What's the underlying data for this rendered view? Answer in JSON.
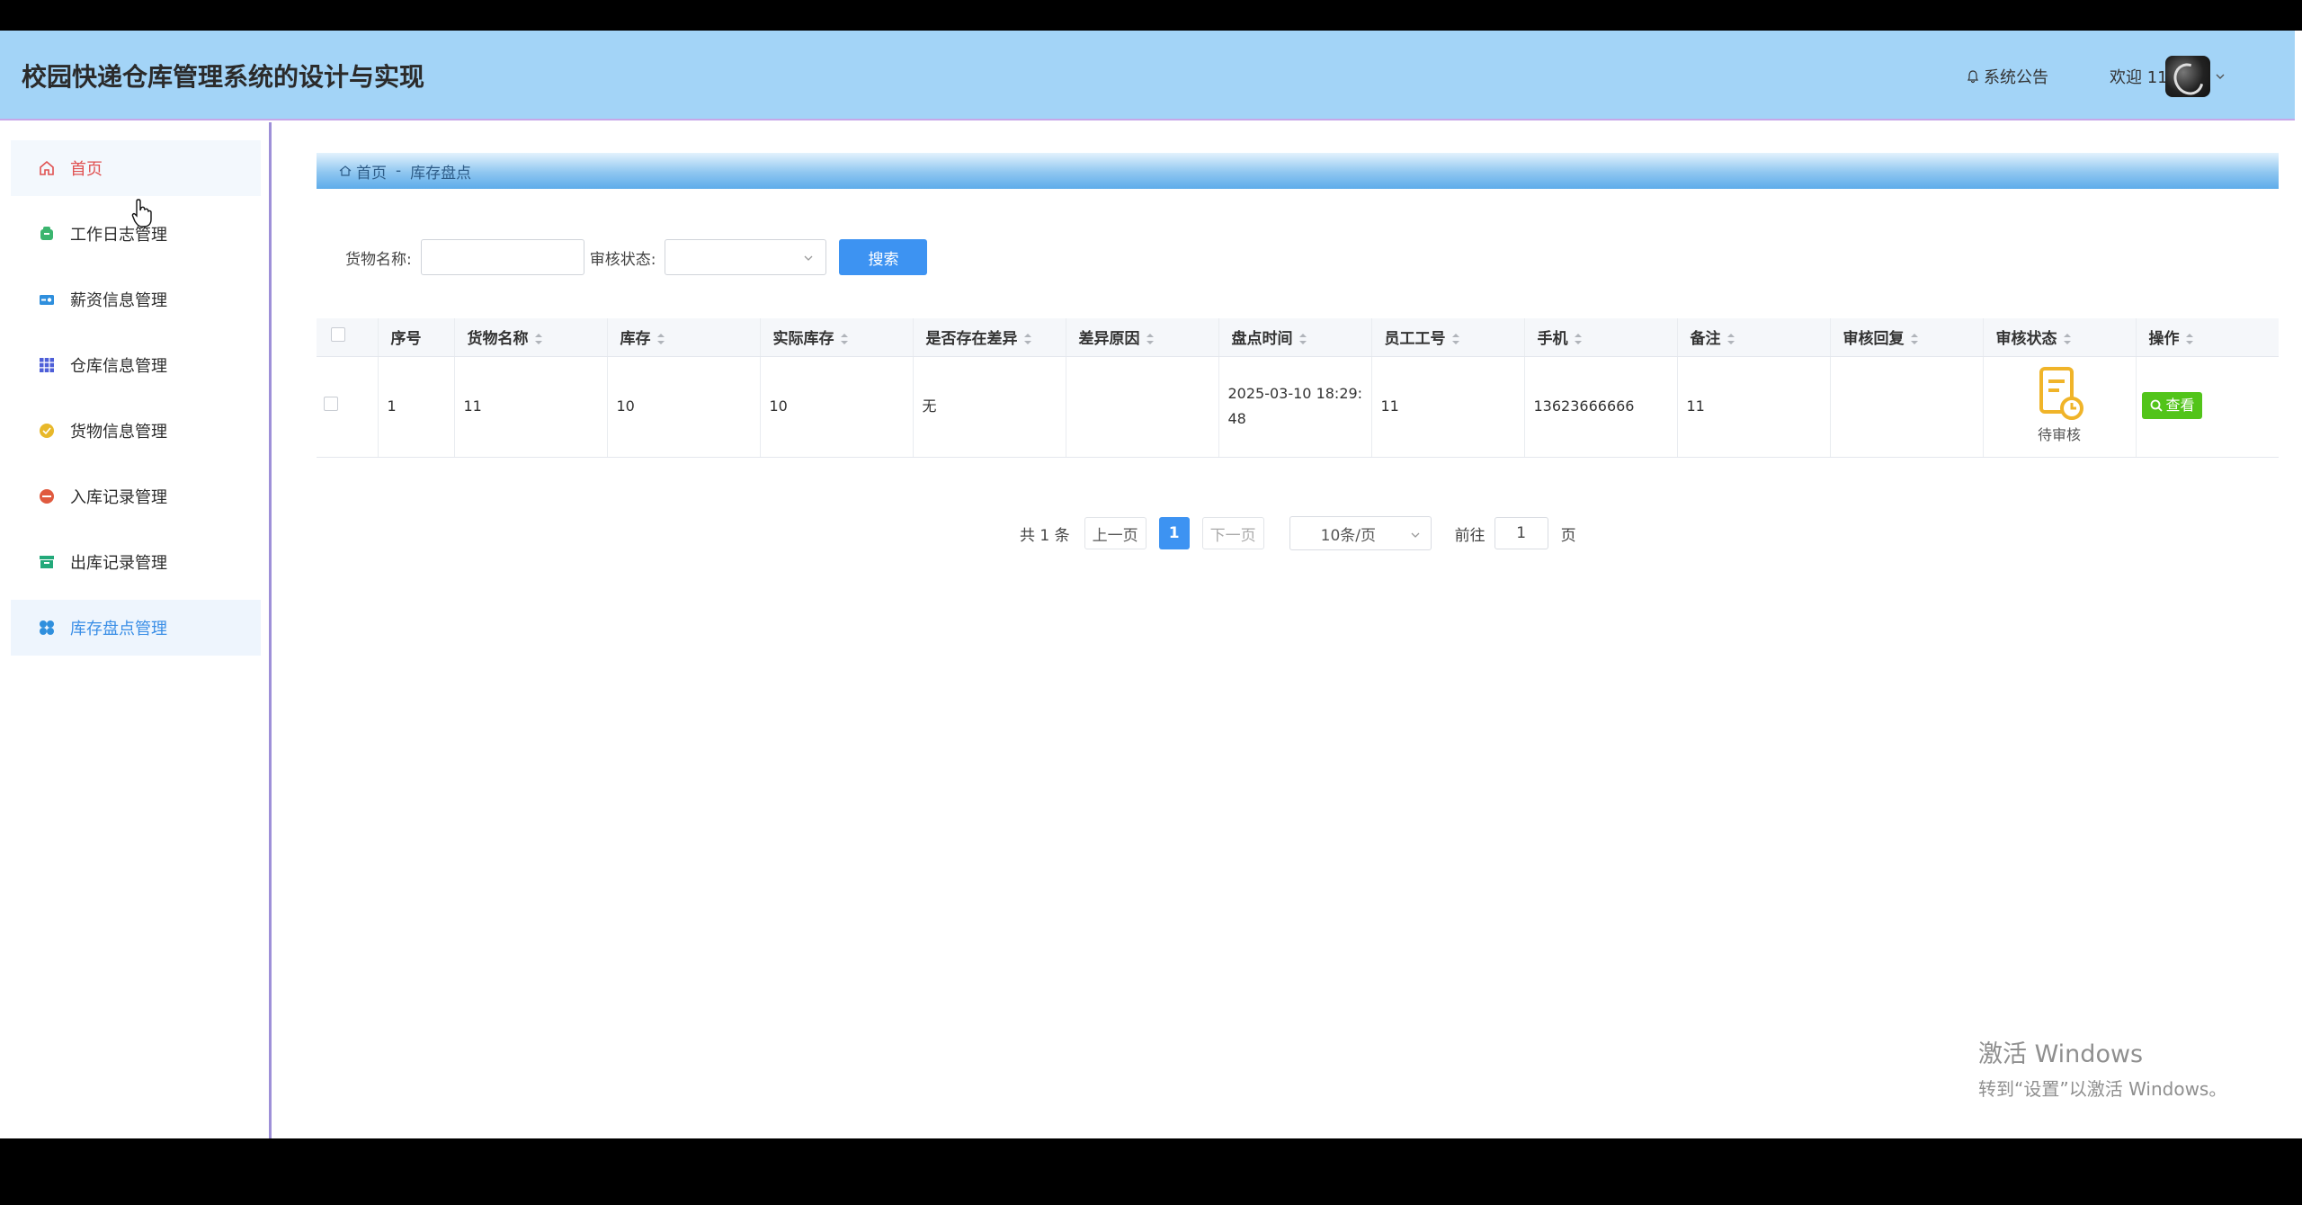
{
  "header": {
    "title": "校园快递仓库管理系统的设计与实现",
    "notice_label": "系统公告",
    "welcome_text": "欢迎 11"
  },
  "sidebar": {
    "items": [
      {
        "label": "首页",
        "icon": "home-icon",
        "active": true
      },
      {
        "label": "工作日志管理",
        "icon": "worklog-icon"
      },
      {
        "label": "薪资信息管理",
        "icon": "salary-icon"
      },
      {
        "label": "仓库信息管理",
        "icon": "warehouse-icon"
      },
      {
        "label": "货物信息管理",
        "icon": "goods-icon"
      },
      {
        "label": "入库记录管理",
        "icon": "inbound-icon"
      },
      {
        "label": "出库记录管理",
        "icon": "outbound-icon"
      },
      {
        "label": "库存盘点管理",
        "icon": "inventory-icon",
        "highlighted": true
      }
    ]
  },
  "breadcrumb": {
    "home": "首页",
    "separator": "-",
    "current": "库存盘点"
  },
  "search": {
    "goods_name_label": "货物名称:",
    "goods_name_value": "",
    "status_label": "审核状态:",
    "status_value": "",
    "search_button": "搜索"
  },
  "table": {
    "columns": [
      "序号",
      "货物名称",
      "库存",
      "实际库存",
      "是否存在差异",
      "差异原因",
      "盘点时间",
      "员工工号",
      "手机",
      "备注",
      "审核回复",
      "审核状态",
      "操作"
    ],
    "rows": [
      {
        "index": "1",
        "goods_name": "11",
        "stock": "10",
        "actual_stock": "10",
        "has_difference": "无",
        "difference_reason": "",
        "check_time": "2025-03-10 18:29:48",
        "employee_no": "11",
        "phone": "13623666666",
        "remark": "11",
        "review_reply": "",
        "review_status": "待审核",
        "action_label": "查看"
      }
    ]
  },
  "pagination": {
    "total_text": "共 1 条",
    "prev_label": "上一页",
    "current_page": "1",
    "next_label": "下一页",
    "page_size": "10条/页",
    "goto_label": "前往",
    "goto_value": "1",
    "page_unit": "页"
  },
  "watermark": {
    "line1": "激活 Windows",
    "line2": "转到“设置”以激活 Windows。"
  },
  "colors": {
    "header_bg": "#a3d4f7",
    "accent": "#3d93f2",
    "view_button": "#52c41a",
    "status_icon": "#f0b429"
  }
}
